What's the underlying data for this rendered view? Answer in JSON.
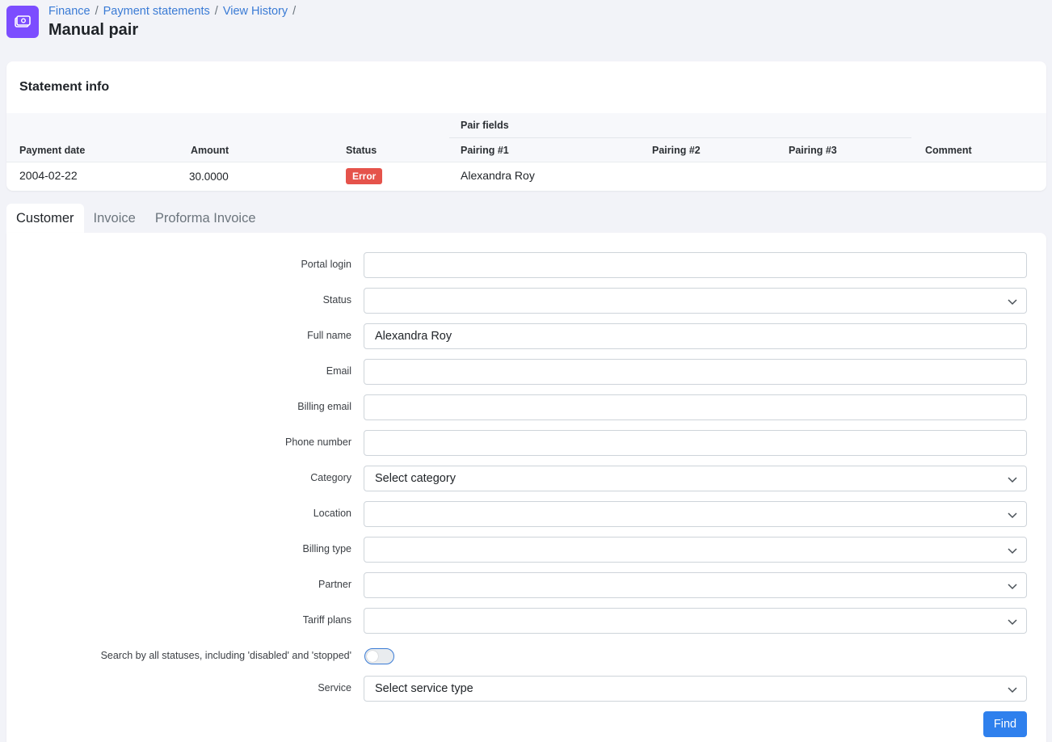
{
  "header": {
    "breadcrumb": [
      "Finance",
      "Payment statements",
      "View History"
    ],
    "breadcrumb_separator": "/",
    "title": "Manual pair"
  },
  "statement_info": {
    "title": "Statement info",
    "pair_fields_header": "Pair fields",
    "columns": {
      "payment_date": "Payment date",
      "amount": "Amount",
      "status": "Status",
      "pairing1": "Pairing #1",
      "pairing2": "Pairing #2",
      "pairing3": "Pairing #3",
      "comment": "Comment"
    },
    "row": {
      "payment_date": "2004-02-22",
      "amount": "30.0000",
      "status": "Error",
      "pairing1": "Alexandra Roy",
      "pairing2": "",
      "pairing3": "",
      "comment": ""
    }
  },
  "tabs": [
    "Customer",
    "Invoice",
    "Proforma Invoice"
  ],
  "active_tab": "Customer",
  "form": {
    "fields": [
      {
        "label": "Portal login",
        "value": "",
        "type": "text"
      },
      {
        "label": "Status",
        "value": "",
        "type": "select"
      },
      {
        "label": "Full name",
        "value": "Alexandra Roy",
        "type": "text"
      },
      {
        "label": "Email",
        "value": "",
        "type": "text"
      },
      {
        "label": "Billing email",
        "value": "",
        "type": "text"
      },
      {
        "label": "Phone number",
        "value": "",
        "type": "text"
      },
      {
        "label": "Category",
        "value": "Select category",
        "type": "select"
      },
      {
        "label": "Location",
        "value": "",
        "type": "select"
      },
      {
        "label": "Billing type",
        "value": "",
        "type": "select"
      },
      {
        "label": "Partner",
        "value": "",
        "type": "select"
      },
      {
        "label": "Tariff plans",
        "value": "",
        "type": "select"
      }
    ],
    "toggle_label": "Search by all statuses, including 'disabled' and 'stopped'",
    "toggle_on": false,
    "service": {
      "label": "Service",
      "value": "Select service type"
    },
    "find_label": "Find"
  },
  "colors": {
    "accent": "#2f80ed",
    "app_icon_bg": "#7c4dff",
    "error_badge": "#e5534b",
    "link": "#3a7bd5"
  },
  "icons": {
    "app": "money-icon",
    "select": "chevron-down-icon"
  }
}
